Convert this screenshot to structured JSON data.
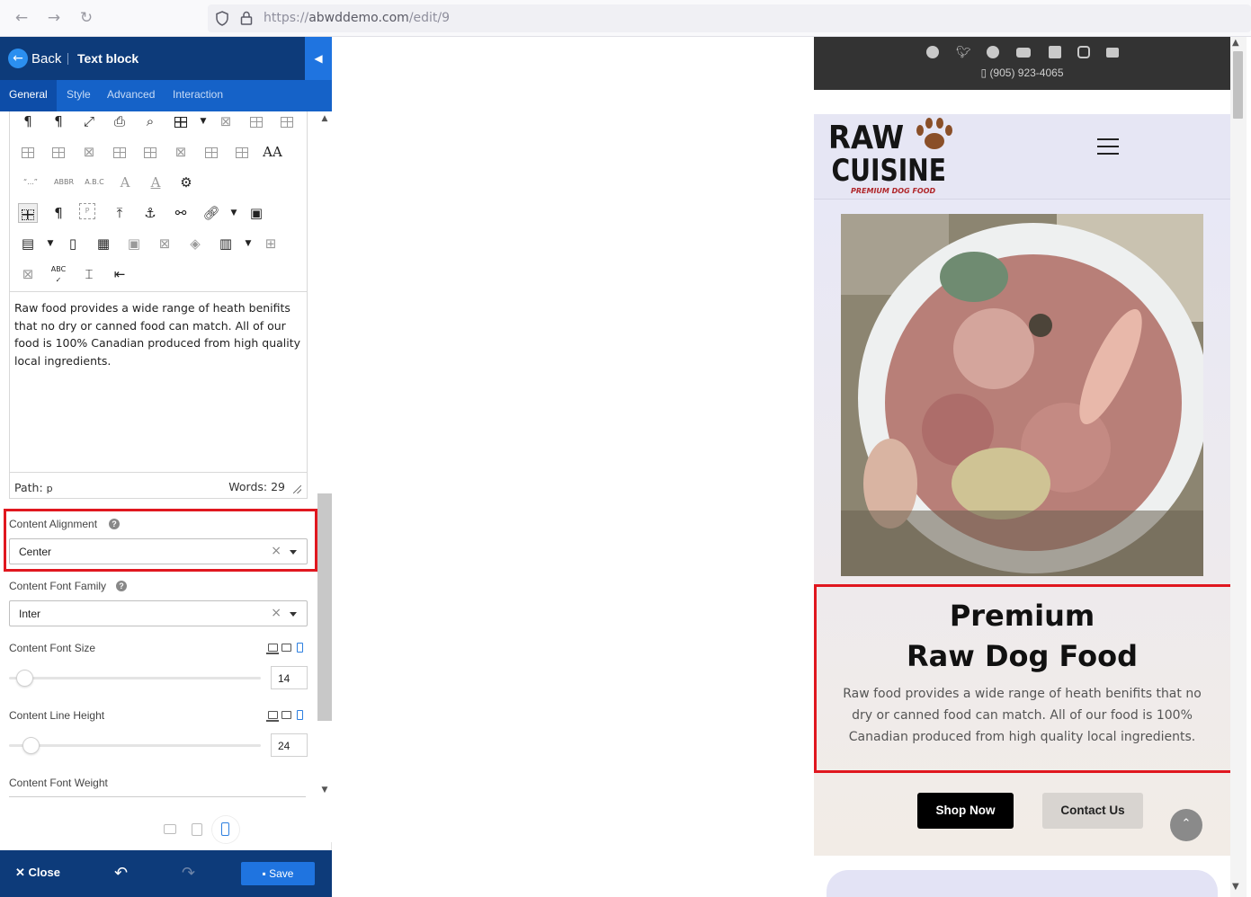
{
  "browser": {
    "back_icon": "arrow-left-icon",
    "forward_icon": "arrow-right-icon",
    "reload_icon": "reload-icon",
    "url_prefix": "https://",
    "url_host": "abwddemo.com",
    "url_path": "/edit/9"
  },
  "panel": {
    "back_label": "Back",
    "title": "Text block",
    "tabs": [
      "General",
      "Style",
      "Advanced",
      "Interaction"
    ],
    "active_tab": "General",
    "editor_text": "Raw food provides a wide range of heath benifits that no dry or canned food can match. All of our food is 100% Canadian produced from high quality local ingredients.",
    "path_label": "Path:",
    "path_value": "p",
    "words_label": "Words: 29",
    "content_alignment_label": "Content Alignment",
    "content_alignment_value": "Center",
    "font_family_label": "Content Font Family",
    "font_family_value": "Inter",
    "font_size_label": "Content Font Size",
    "font_size_value": "14",
    "line_height_label": "Content Line Height",
    "line_height_value": "24",
    "font_weight_label": "Content Font Weight",
    "tool_labels": {
      "quote": "“...”",
      "abbr": "ABBR",
      "abc": "A.B.C",
      "spell": "ABC"
    }
  },
  "footer": {
    "close_label": "Close",
    "save_label": "Save"
  },
  "preview": {
    "phone": "(905) 923-4065",
    "logo_line1": "RAW",
    "logo_line2": "CUISINE",
    "logo_tag": "PREMIUM DOG FOOD",
    "hero_title_line1": "Premium",
    "hero_title_line2": "Raw Dog Food",
    "hero_text": "Raw food provides a wide range of heath benifits that no dry or canned food can match. All of our food is 100% Canadian produced from high quality local ingredients.",
    "shop_label": "Shop Now",
    "contact_label": "Contact Us",
    "social_icons": [
      "facebook-icon",
      "twitter-icon",
      "pinterest-icon",
      "youtube-icon",
      "linkedin-icon",
      "instagram-icon",
      "flickr-icon"
    ]
  },
  "colors": {
    "panel_header": "#0d3b7a",
    "tab_bar": "#1562c8",
    "accent": "#1f74e0",
    "highlight": "#e0171f"
  }
}
